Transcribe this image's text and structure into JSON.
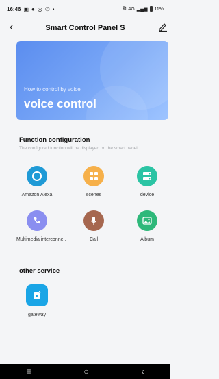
{
  "status_bar": {
    "time": "16:46",
    "icons": [
      "image-icon",
      "chat-icon",
      "whatsapp-icon",
      "phone-icon",
      "dot-icon"
    ],
    "network": "4G",
    "battery": "11%"
  },
  "header": {
    "back_icon": "back-arrow-icon",
    "title": "Smart Control Panel S",
    "edit_icon": "edit-pencil-icon"
  },
  "banner": {
    "subtitle": "How to control by voice",
    "heading": "voice control",
    "colors": [
      "#5b8def",
      "#9ec4ff"
    ]
  },
  "function_configuration": {
    "title": "Function configuration",
    "hint": "The configured function will be displayed on the smart panel",
    "items": [
      {
        "label": "Amazon Alexa",
        "icon": "alexa-icon",
        "color": "#1f9ad6"
      },
      {
        "label": "scenes",
        "icon": "scenes-icon",
        "color": "#f6b04a"
      },
      {
        "label": "device",
        "icon": "device-icon",
        "color": "#2bc4a4"
      },
      {
        "label": "Multimedia interconne..",
        "icon": "multimedia-icon",
        "color": "#8a8ef0"
      },
      {
        "label": "Call",
        "icon": "call-icon",
        "color": "#a6674f"
      },
      {
        "label": "Album",
        "icon": "album-icon",
        "color": "#2eb87a"
      }
    ]
  },
  "other_service": {
    "title": "other service",
    "items": [
      {
        "label": "gateway",
        "icon": "gateway-icon",
        "color": "#1aa5e6"
      }
    ]
  },
  "nav_bar": {
    "items": [
      "menu-icon",
      "home-icon",
      "back-icon"
    ]
  }
}
